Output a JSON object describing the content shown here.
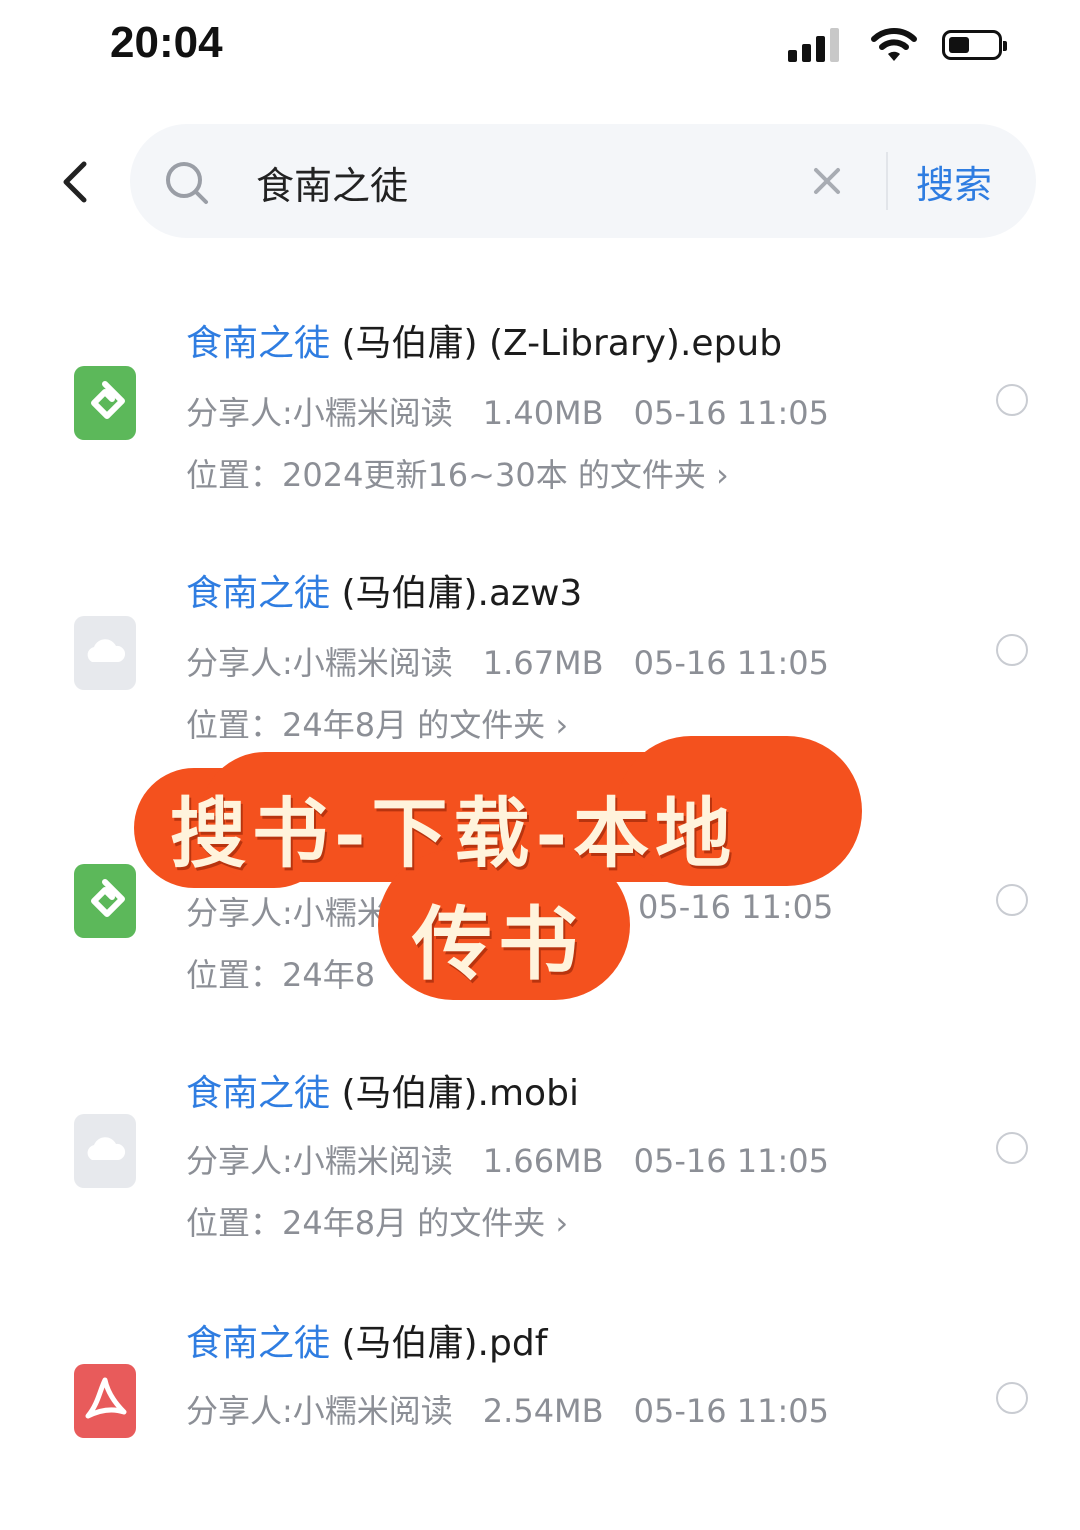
{
  "status_bar": {
    "time": "20:04"
  },
  "search": {
    "query": "食南之徒",
    "button_label": "搜索"
  },
  "results": [
    {
      "title_highlight": "食南之徒",
      "title_rest": " (马伯庸) (Z-Library).epub",
      "file_type": "epub",
      "sharer": "分享人:小糯米阅读",
      "size": "1.40MB",
      "date": "05-16 11:05",
      "location": "位置：2024更新16~30本 的文件夹 ›"
    },
    {
      "title_highlight": "食南之徒",
      "title_rest": " (马伯庸).azw3",
      "file_type": "unknown",
      "sharer": "分享人:小糯米阅读",
      "size": "1.67MB",
      "date": "05-16 11:05",
      "location": "位置：24年8月 的文件夹 ›"
    },
    {
      "title_highlight": "",
      "title_rest": "",
      "file_type": "epub",
      "sharer": "分享人:小糯米",
      "size": "",
      "date": "05-16 11:05",
      "location": "位置：24年8"
    },
    {
      "title_highlight": "食南之徒",
      "title_rest": " (马伯庸).mobi",
      "file_type": "unknown",
      "sharer": "分享人:小糯米阅读",
      "size": "1.66MB",
      "date": "05-16 11:05",
      "location": "位置：24年8月 的文件夹 ›"
    },
    {
      "title_highlight": "食南之徒",
      "title_rest": " (马伯庸).pdf",
      "file_type": "pdf",
      "sharer": "分享人:小糯米阅读",
      "size": "2.54MB",
      "date": "05-16 11:05",
      "location": ""
    }
  ],
  "overlay": {
    "line1": "搜书-下载-本地",
    "line2": "传书"
  },
  "colors": {
    "accent": "#2f7de1",
    "sticker": "#f4511e"
  }
}
